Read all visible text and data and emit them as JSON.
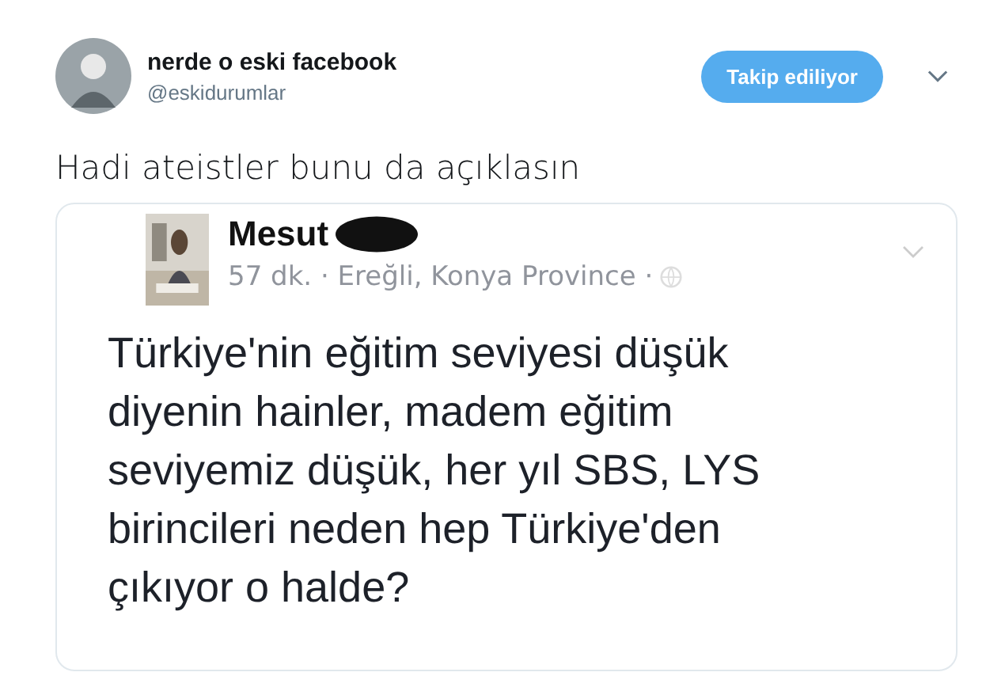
{
  "account": {
    "name": "nerde o eski facebook",
    "handle": "@eskidurumlar"
  },
  "follow_button": {
    "label": "Takip ediliyor"
  },
  "tweet_text": "Hadi ateistler bunu da açıklasın",
  "embedded_post": {
    "author": "Mesut",
    "meta": "57 dk. · Ereğli, Konya Province ·",
    "body_lines": [
      "Türkiye'nin eğitim seviyesi düşük",
      "diyenin hainler, madem eğitim",
      "seviyemiz düşük, her yıl SBS, LYS",
      "birincileri neden hep Türkiye'den",
      "çıkıyor o halde?"
    ]
  }
}
